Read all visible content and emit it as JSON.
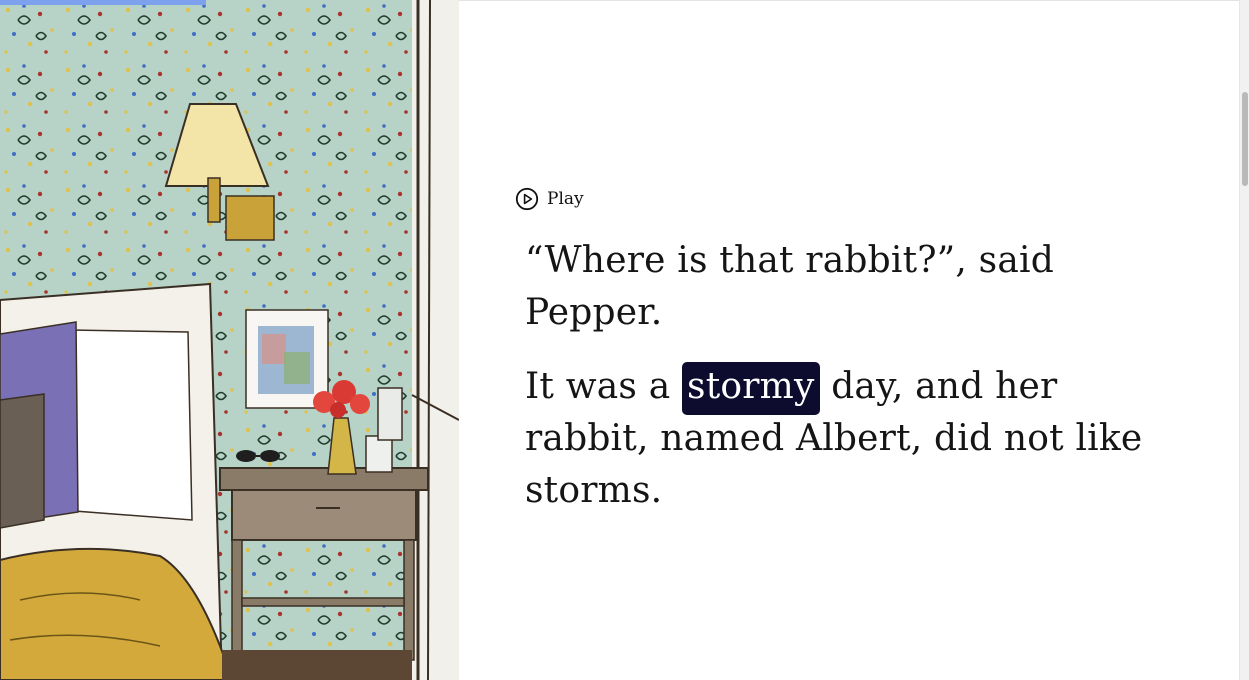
{
  "reader": {
    "progress_fraction": 0.165
  },
  "illustration": {
    "icon": "bedroom-illustration",
    "colors": {
      "wallpaper": "#b9d3c9",
      "lampshade": "#f3e5a8",
      "blanket": "#d2a93a",
      "pillow_purple": "#7a70b5"
    }
  },
  "player": {
    "play_label": "Play",
    "icon": "play-circle-icon"
  },
  "story": {
    "paragraph_1": "“Where is that rabbit?”, said Pepper.",
    "paragraph_2_before": "It was a ",
    "highlighted_word": "stormy",
    "paragraph_2_after": " day, and her rabbit, named Albert, did not like storms.",
    "highlight_color": "#0d0b2e"
  }
}
